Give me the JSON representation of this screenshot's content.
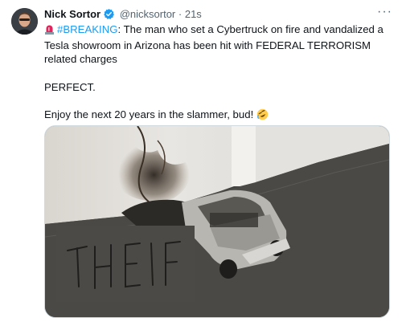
{
  "tweet": {
    "author_name": "Nick Sortor",
    "handle": "@nicksortor",
    "separator": "·",
    "time": "21s",
    "more_label": "···",
    "hashtag": "#BREAKING",
    "text_after_hashtag": ": The man who set a Cybertruck on fire and vandalized a Tesla showroom in Arizona has been hit with FEDERAL TERRORISM related charges",
    "line2": "PERFECT.",
    "line3": "Enjoy the next 20 years in the slammer, bud!",
    "emojis": [
      "rotating-light",
      "rolling-on-floor-laughing"
    ],
    "accent_color": "#1d9bf0"
  },
  "media": {
    "graffiti_text": "THEIF"
  }
}
